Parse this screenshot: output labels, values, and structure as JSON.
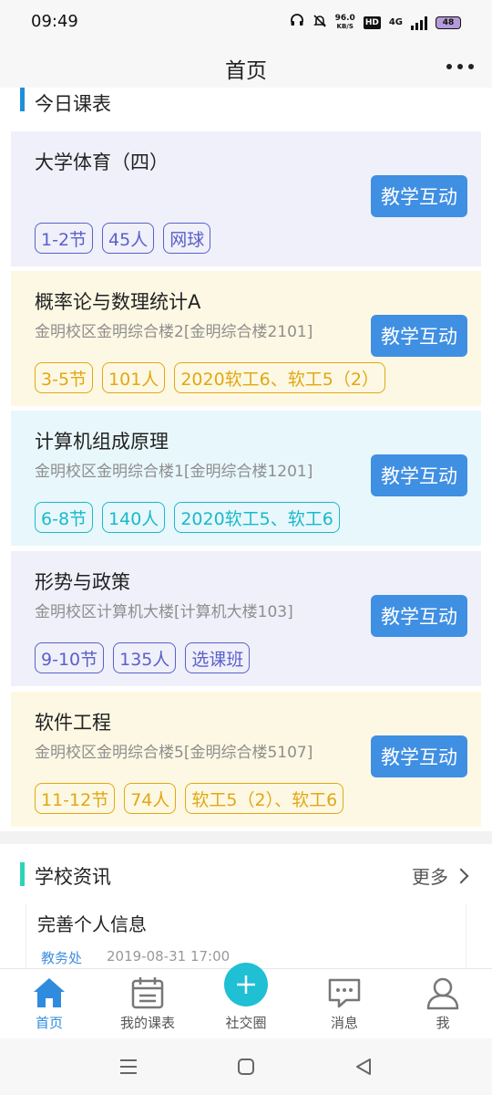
{
  "status": {
    "time": "09:49",
    "speed_value": "96.0",
    "speed_unit": "KB/S",
    "hd": "HD",
    "network": "4G",
    "battery": "48"
  },
  "header": {
    "title": "首页"
  },
  "schedule": {
    "title": "今日课表",
    "accent_color": "#1e90d8",
    "button_label": "教学互动",
    "courses": [
      {
        "name": "大学体育（四）",
        "location": "",
        "tags": [
          "1-2节",
          "45人",
          "网球"
        ],
        "color": "#5c60c8"
      },
      {
        "name": "概率论与数理统计A",
        "location": "金明校区金明综合楼2[金明综合楼2101]",
        "tags": [
          "3-5节",
          "101人",
          "2020软工6、软工5（2）"
        ],
        "color": "#e1a814"
      },
      {
        "name": "计算机组成原理",
        "location": "金明校区金明综合楼1[金明综合楼1201]",
        "tags": [
          "6-8节",
          "140人",
          "2020软工5、软工6"
        ],
        "color": "#19b9cc"
      },
      {
        "name": "形势与政策",
        "location": "金明校区计算机大楼[计算机大楼103]",
        "tags": [
          "9-10节",
          "135人",
          "选课班"
        ],
        "color": "#5c60c8"
      },
      {
        "name": "软件工程",
        "location": "金明校区金明综合楼5[金明综合楼5107]",
        "tags": [
          "11-12节",
          "74人",
          "软工5（2）、软工6"
        ],
        "color": "#e1a814"
      }
    ]
  },
  "news": {
    "title": "学校资讯",
    "accent_color": "#2ed3b7",
    "more_label": "更多",
    "items": [
      {
        "title": "完善个人信息",
        "source": "教务处",
        "time": "2019-08-31 17:00"
      }
    ]
  },
  "tabs": [
    {
      "label": "首页",
      "icon": "home-icon",
      "active": true
    },
    {
      "label": "我的课表",
      "icon": "calendar-icon",
      "active": false
    },
    {
      "label": "社交圈",
      "icon": "plus-icon",
      "active": false
    },
    {
      "label": "消息",
      "icon": "message-icon",
      "active": false
    },
    {
      "label": "我",
      "icon": "user-icon",
      "active": false
    }
  ]
}
